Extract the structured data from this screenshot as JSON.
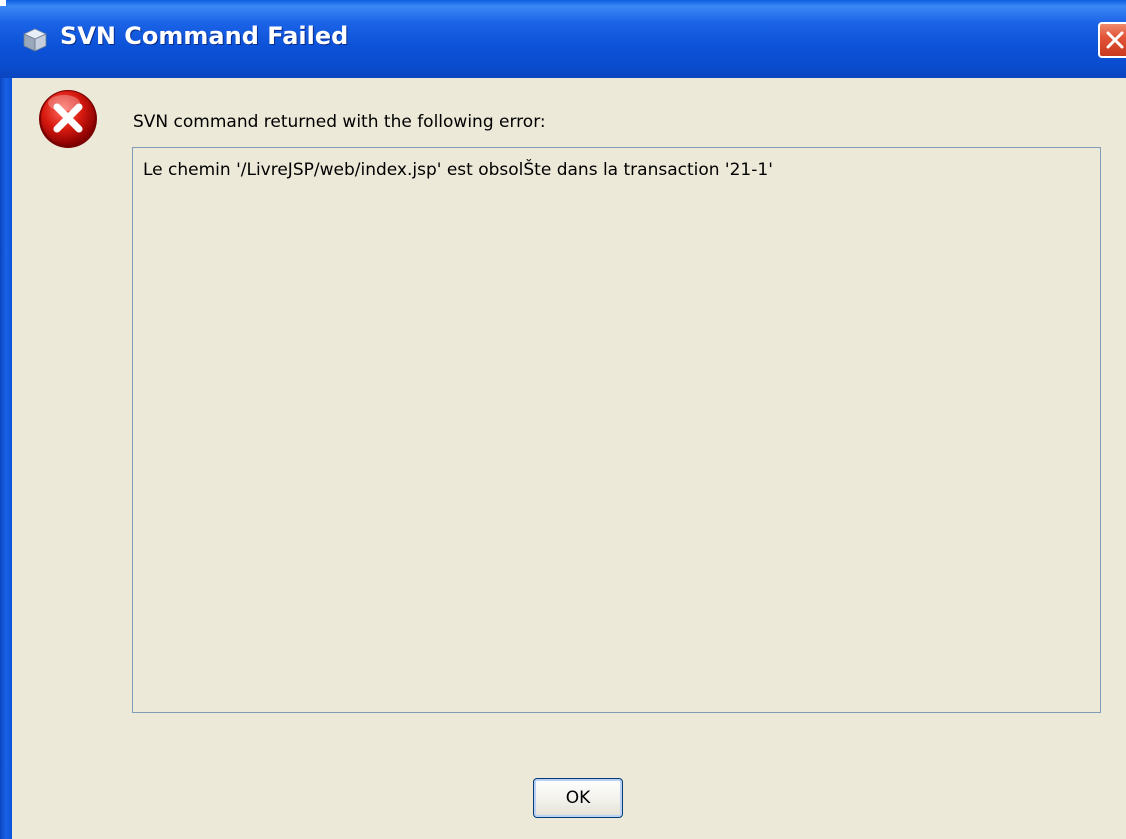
{
  "window": {
    "title": "SVN Command Failed",
    "icon": "svn-cube-icon",
    "close_icon": "close-icon"
  },
  "dialog": {
    "icon": "error-icon",
    "message": "SVN command returned with the following error:",
    "error_detail": "Le chemin '/LivreJSP/web/index.jsp' est obsolŠte dans la transaction '21-1'",
    "ok_label": "OK"
  },
  "colors": {
    "titlebar": "#0c52d8",
    "background": "#ece9d8",
    "error_red": "#c8000a",
    "close_red": "#e2553a"
  }
}
